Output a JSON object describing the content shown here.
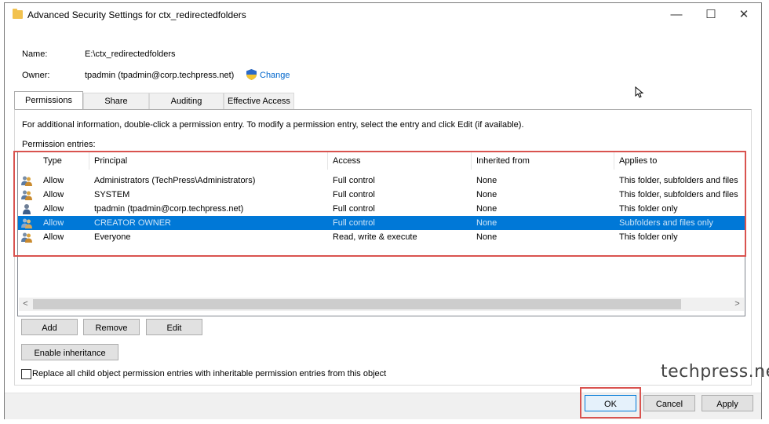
{
  "window": {
    "title": "Advanced Security Settings for ctx_redirectedfolders",
    "controls": {
      "minimize": "—",
      "maximize": "☐",
      "close": "✕"
    }
  },
  "fields": {
    "name_label": "Name:",
    "name_value": "E:\\ctx_redirectedfolders",
    "owner_label": "Owner:",
    "owner_value": "tpadmin (tpadmin@corp.techpress.net)",
    "change_link": "Change"
  },
  "tabs": [
    {
      "label": "Permissions",
      "active": true
    },
    {
      "label": "Share",
      "active": false
    },
    {
      "label": "Auditing",
      "active": false
    },
    {
      "label": "Effective Access",
      "active": false
    }
  ],
  "info_text": "For additional information, double-click a permission entry. To modify a permission entry, select the entry and click Edit (if available).",
  "entries_label": "Permission entries:",
  "table": {
    "columns": [
      "Type",
      "Principal",
      "Access",
      "Inherited from",
      "Applies to"
    ],
    "rows": [
      {
        "icon": "group-icon",
        "type": "Allow",
        "principal": "Administrators (TechPress\\Administrators)",
        "access": "Full control",
        "inherited": "None",
        "applies": "This folder, subfolders and files",
        "selected": false
      },
      {
        "icon": "group-icon",
        "type": "Allow",
        "principal": "SYSTEM",
        "access": "Full control",
        "inherited": "None",
        "applies": "This folder, subfolders and files",
        "selected": false
      },
      {
        "icon": "user-icon",
        "type": "Allow",
        "principal": "tpadmin (tpadmin@corp.techpress.net)",
        "access": "Full control",
        "inherited": "None",
        "applies": "This folder only",
        "selected": false
      },
      {
        "icon": "group-icon",
        "type": "Allow",
        "principal": "CREATOR OWNER",
        "access": "Full control",
        "inherited": "None",
        "applies": "Subfolders and files only",
        "selected": true
      },
      {
        "icon": "group-icon",
        "type": "Allow",
        "principal": "Everyone",
        "access": "Read, write & execute",
        "inherited": "None",
        "applies": "This folder only",
        "selected": false
      }
    ]
  },
  "scroll_arrows": {
    "left": "<",
    "right": ">"
  },
  "buttons": {
    "add": "Add",
    "remove": "Remove",
    "edit": "Edit",
    "enable_inheritance": "Enable inheritance",
    "ok": "OK",
    "cancel": "Cancel",
    "apply": "Apply"
  },
  "replace_checkbox": {
    "label": "Replace all child object permission entries with inheritable permission entries from this object",
    "checked": false
  },
  "watermark": "techpress.net",
  "colors": {
    "selection": "#0078d7",
    "highlight_box": "#d9534f",
    "link": "#0066cc"
  }
}
